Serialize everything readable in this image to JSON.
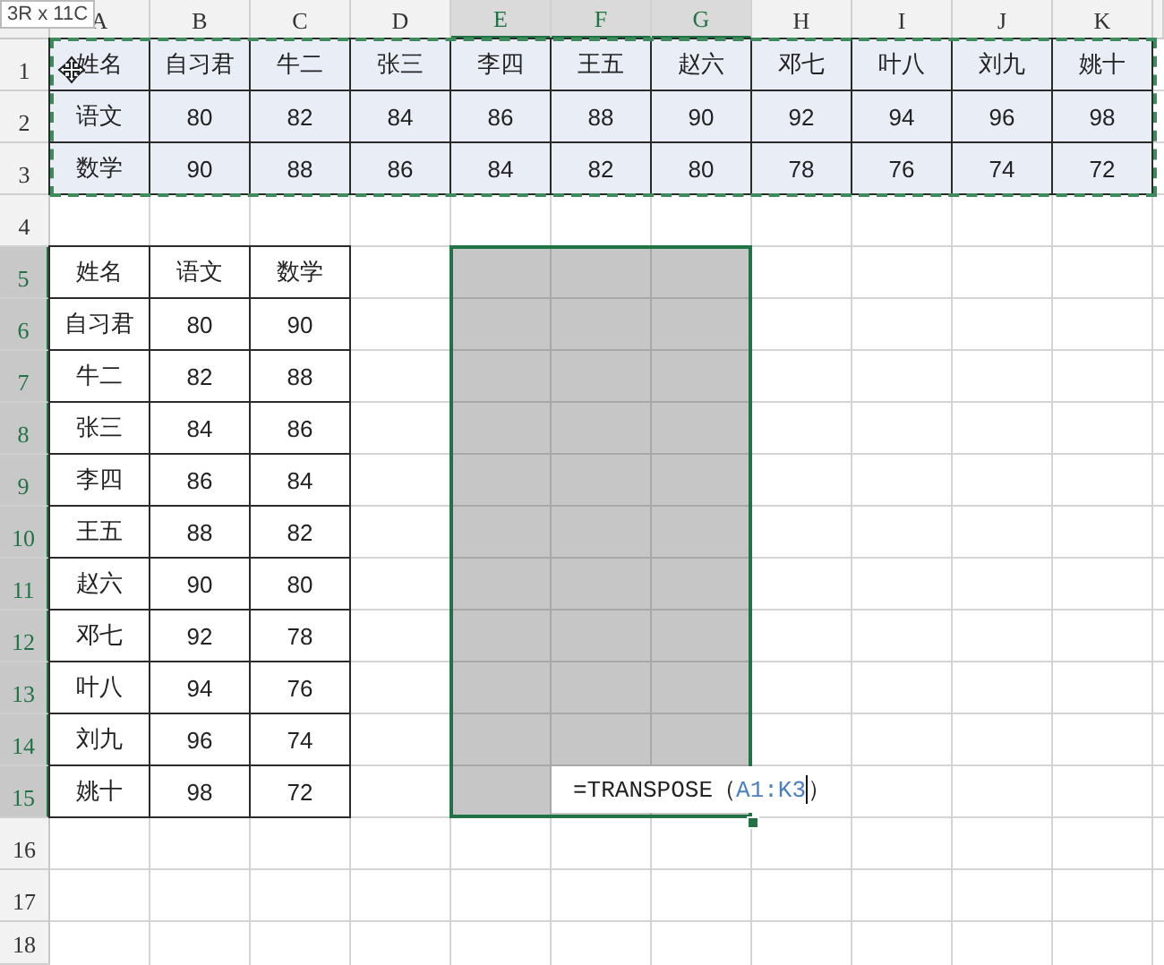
{
  "range_tooltip": "3R x 11C",
  "columns": [
    {
      "label": "A",
      "selected": false
    },
    {
      "label": "B",
      "selected": false
    },
    {
      "label": "C",
      "selected": false
    },
    {
      "label": "D",
      "selected": false
    },
    {
      "label": "E",
      "selected": true
    },
    {
      "label": "F",
      "selected": true
    },
    {
      "label": "G",
      "selected": true
    },
    {
      "label": "H",
      "selected": false
    },
    {
      "label": "I",
      "selected": false
    },
    {
      "label": "J",
      "selected": false
    },
    {
      "label": "K",
      "selected": false
    }
  ],
  "rows": [
    {
      "label": "1",
      "selected": false
    },
    {
      "label": "2",
      "selected": false
    },
    {
      "label": "3",
      "selected": false
    },
    {
      "label": "4",
      "selected": false
    },
    {
      "label": "5",
      "selected": true
    },
    {
      "label": "6",
      "selected": true
    },
    {
      "label": "7",
      "selected": true
    },
    {
      "label": "8",
      "selected": true
    },
    {
      "label": "9",
      "selected": true
    },
    {
      "label": "10",
      "selected": true
    },
    {
      "label": "11",
      "selected": true
    },
    {
      "label": "12",
      "selected": true
    },
    {
      "label": "13",
      "selected": true
    },
    {
      "label": "14",
      "selected": true
    },
    {
      "label": "15",
      "selected": true
    },
    {
      "label": "16",
      "selected": false
    },
    {
      "label": "17",
      "selected": false
    },
    {
      "label": "18",
      "selected": false
    }
  ],
  "source_table": {
    "rows": [
      [
        "姓名",
        "自习君",
        "牛二",
        "张三",
        "李四",
        "王五",
        "赵六",
        "邓七",
        "叶八",
        "刘九",
        "姚十"
      ],
      [
        "语文",
        "80",
        "82",
        "84",
        "86",
        "88",
        "90",
        "92",
        "94",
        "96",
        "98"
      ],
      [
        "数学",
        "90",
        "88",
        "86",
        "84",
        "82",
        "80",
        "78",
        "76",
        "74",
        "72"
      ]
    ]
  },
  "transposed_table": {
    "rows": [
      [
        "姓名",
        "语文",
        "数学"
      ],
      [
        "自习君",
        "80",
        "90"
      ],
      [
        "牛二",
        "82",
        "88"
      ],
      [
        "张三",
        "84",
        "86"
      ],
      [
        "李四",
        "86",
        "84"
      ],
      [
        "王五",
        "88",
        "82"
      ],
      [
        "赵六",
        "90",
        "80"
      ],
      [
        "邓七",
        "92",
        "78"
      ],
      [
        "叶八",
        "94",
        "76"
      ],
      [
        "刘九",
        "96",
        "74"
      ],
      [
        "姚十",
        "98",
        "72"
      ]
    ]
  },
  "formula_editor": {
    "function": "=TRANSPOSE（",
    "reference": "A1:K3",
    "closing": "）"
  }
}
